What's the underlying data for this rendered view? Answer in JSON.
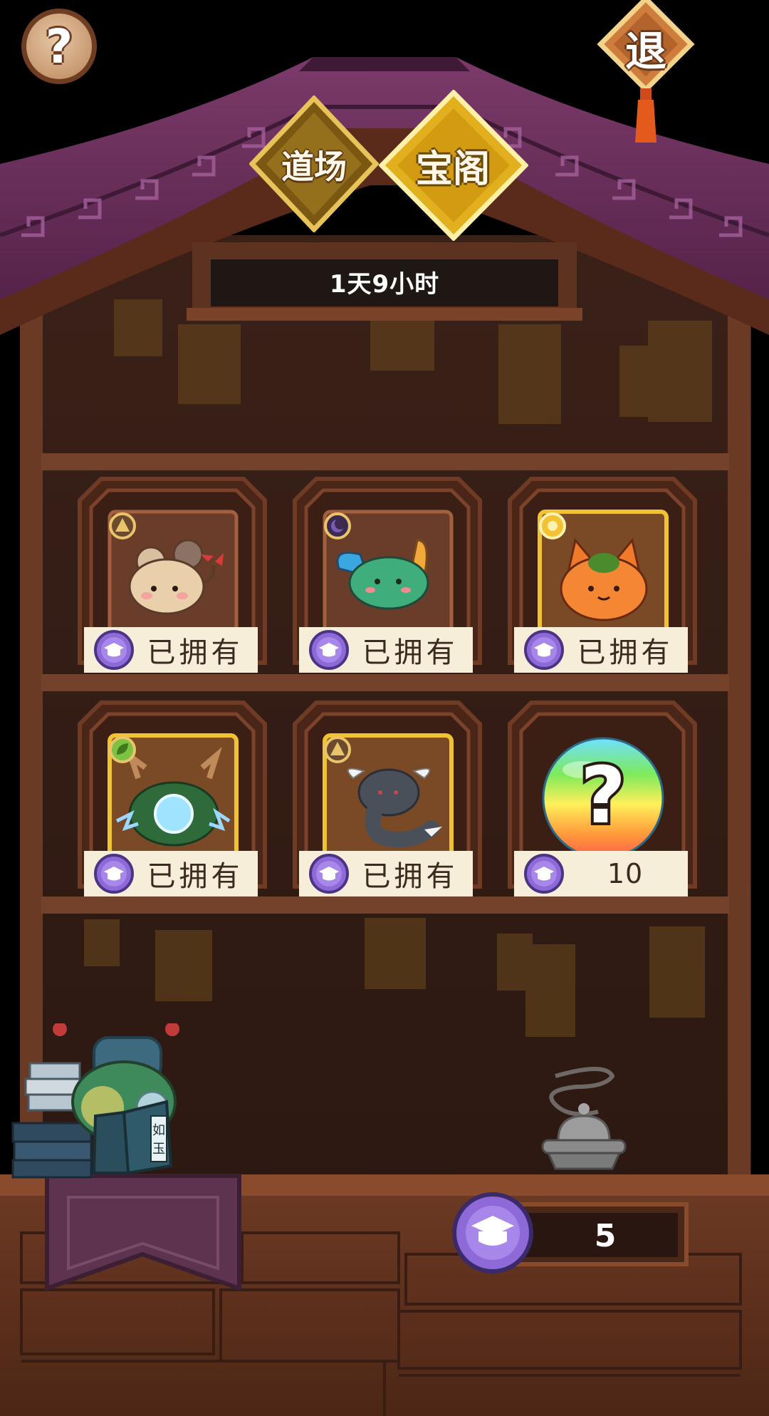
{
  "header": {
    "help_icon": "question-mark-icon",
    "exit_label": "退",
    "tabs": [
      {
        "label": "道场",
        "selected": false
      },
      {
        "label": "宝阁",
        "selected": true
      }
    ],
    "timer_text": "1天9小时"
  },
  "shop": {
    "items": [
      {
        "creature": "mouse-creature",
        "element_icon": "earth-element-icon",
        "price_text": "已拥有",
        "owned": true
      },
      {
        "creature": "winged-slime-creature",
        "element_icon": "dark-element-icon",
        "price_text": "已拥有",
        "owned": true
      },
      {
        "creature": "fox-creature",
        "element_icon": "sun-element-icon",
        "price_text": "已拥有",
        "owned": true
      },
      {
        "creature": "thunder-turtle-creature",
        "element_icon": "leaf-element-icon",
        "price_text": "已拥有",
        "owned": true
      },
      {
        "creature": "smoke-dragon-creature",
        "element_icon": "earth-element-icon",
        "price_text": "已拥有",
        "owned": true
      },
      {
        "creature": "mystery-egg",
        "element_icon": "",
        "price_text": "10",
        "owned": false
      }
    ]
  },
  "wallet": {
    "currency_icon": "graduation-cap-coin-icon",
    "amount": "5"
  },
  "decor": {
    "book_text": "如玉"
  },
  "colors": {
    "wood_dark": "#3b2016",
    "wood_mid": "#6b3a24",
    "roof_purple": "#6a2e5c",
    "gold": "#e5b52f",
    "coin_purple": "#8e6ad8"
  }
}
